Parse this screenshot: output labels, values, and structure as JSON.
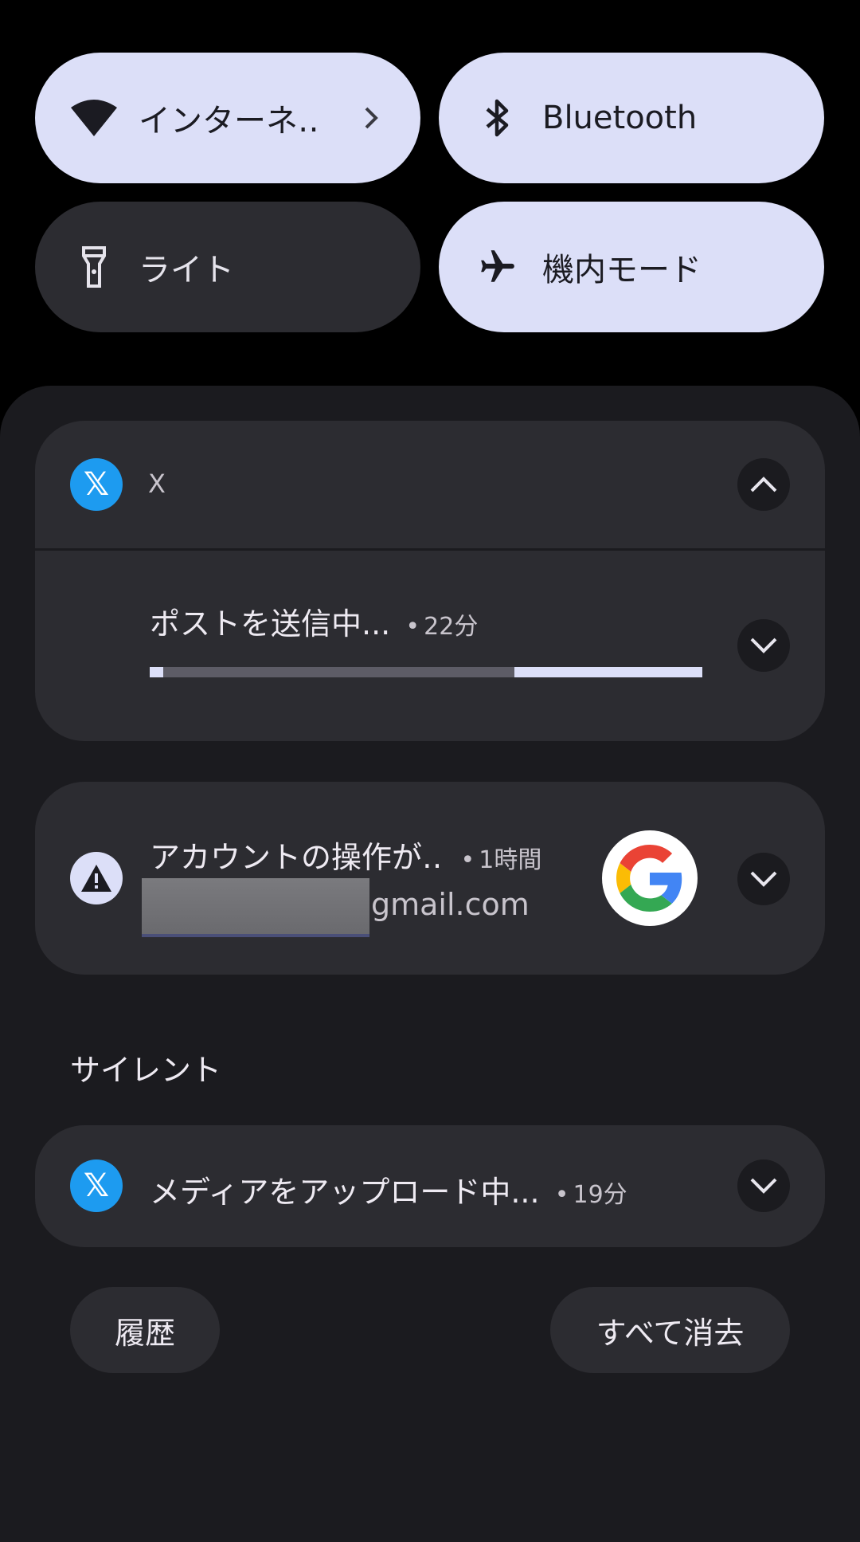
{
  "quick_settings": {
    "tiles": [
      {
        "label": "インターネ‥",
        "state": "on",
        "icon": "wifi-icon"
      },
      {
        "label": "Bluetooth",
        "state": "on",
        "icon": "bluetooth-icon"
      },
      {
        "label": "ライト",
        "state": "off",
        "icon": "flashlight-icon"
      },
      {
        "label": "機内モード",
        "state": "on",
        "icon": "airplane-icon"
      }
    ]
  },
  "notifications": {
    "x_group": {
      "app_name": "X",
      "app_icon": "x-logo-icon",
      "child": {
        "title": "ポストを送信中...",
        "time": "22分",
        "progress": 0.025
      }
    },
    "google": {
      "title": "アカウントの操作が‥",
      "time": "1時間",
      "subtitle": "gmail.com",
      "icon": "warning-icon",
      "large_icon": "google-logo"
    },
    "silent_header": "サイレント",
    "silent_item": {
      "title": "メディアをアップロード中...",
      "time": "19分",
      "app_icon": "x-logo-icon"
    }
  },
  "footer": {
    "history_label": "履歴",
    "clear_all_label": "すべて消去"
  },
  "colors": {
    "tile_on": "#dcdff8",
    "tile_off": "#2c2c31",
    "shade_bg": "#1b1b1f",
    "x_blue": "#1d9bf0"
  }
}
